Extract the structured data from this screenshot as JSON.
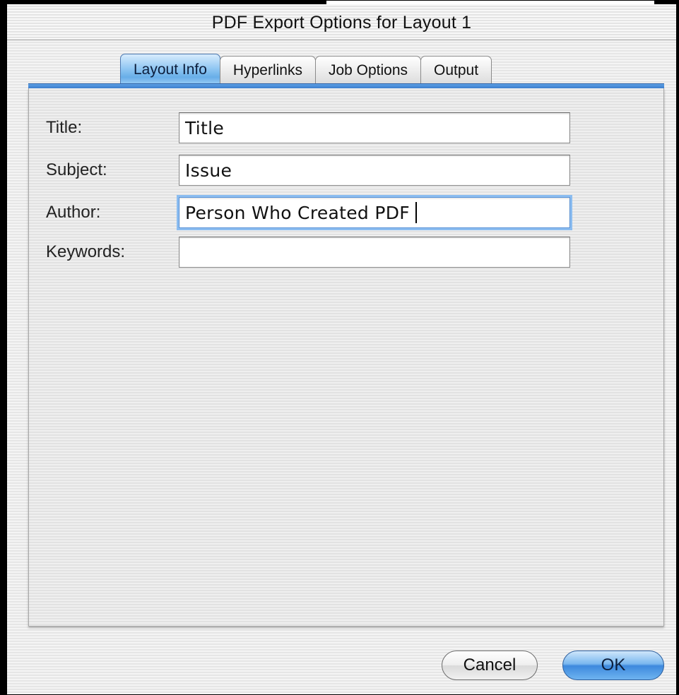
{
  "window": {
    "title": "PDF Export Options for Layout 1"
  },
  "tabs": [
    {
      "label": "Layout Info",
      "active": true
    },
    {
      "label": "Hyperlinks",
      "active": false
    },
    {
      "label": "Job Options",
      "active": false
    },
    {
      "label": "Output",
      "active": false
    }
  ],
  "form": {
    "title": {
      "label": "Title:",
      "value": "Title"
    },
    "subject": {
      "label": "Subject:",
      "value": "Issue"
    },
    "author": {
      "label": "Author:",
      "value": "Person Who Created PDF"
    },
    "keywords": {
      "label": "Keywords:",
      "value": ""
    }
  },
  "buttons": {
    "cancel": "Cancel",
    "ok": "OK"
  },
  "colors": {
    "accent": "#5d9fe3",
    "default_button": "#3d89dd"
  }
}
